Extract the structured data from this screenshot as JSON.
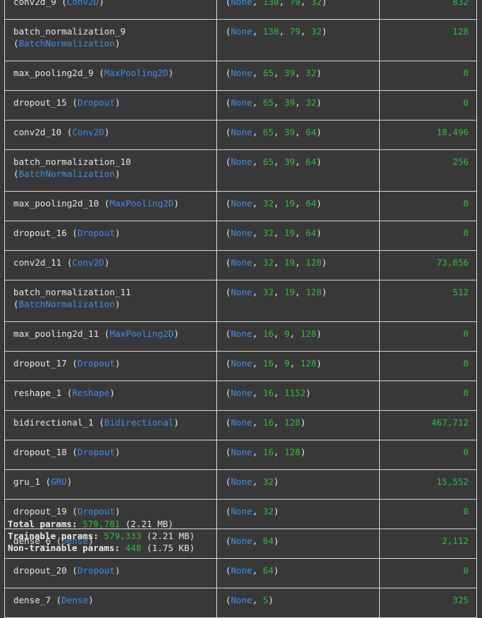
{
  "layers": [
    {
      "name": "conv2d_9",
      "type": "Conv2D",
      "shape": [
        "130",
        "79",
        "32"
      ],
      "params": "832",
      "wrap": false
    },
    {
      "name": "batch_normalization_9",
      "type": "BatchNormalization",
      "shape": [
        "130",
        "79",
        "32"
      ],
      "params": "128",
      "wrap": true
    },
    {
      "name": "max_pooling2d_9",
      "type": "MaxPooling2D",
      "shape": [
        "65",
        "39",
        "32"
      ],
      "params": "0",
      "wrap": false
    },
    {
      "name": "dropout_15",
      "type": "Dropout",
      "shape": [
        "65",
        "39",
        "32"
      ],
      "params": "0",
      "wrap": false
    },
    {
      "name": "conv2d_10",
      "type": "Conv2D",
      "shape": [
        "65",
        "39",
        "64"
      ],
      "params": "18,496",
      "wrap": false
    },
    {
      "name": "batch_normalization_10",
      "type": "BatchNormalization",
      "shape": [
        "65",
        "39",
        "64"
      ],
      "params": "256",
      "wrap": true
    },
    {
      "name": "max_pooling2d_10",
      "type": "MaxPooling2D",
      "shape": [
        "32",
        "19",
        "64"
      ],
      "params": "0",
      "wrap": false
    },
    {
      "name": "dropout_16",
      "type": "Dropout",
      "shape": [
        "32",
        "19",
        "64"
      ],
      "params": "0",
      "wrap": false
    },
    {
      "name": "conv2d_11",
      "type": "Conv2D",
      "shape": [
        "32",
        "19",
        "128"
      ],
      "params": "73,856",
      "wrap": false
    },
    {
      "name": "batch_normalization_11",
      "type": "BatchNormalization",
      "shape": [
        "32",
        "19",
        "128"
      ],
      "params": "512",
      "wrap": true
    },
    {
      "name": "max_pooling2d_11",
      "type": "MaxPooling2D",
      "shape": [
        "16",
        "9",
        "128"
      ],
      "params": "0",
      "wrap": false
    },
    {
      "name": "dropout_17",
      "type": "Dropout",
      "shape": [
        "16",
        "9",
        "128"
      ],
      "params": "0",
      "wrap": false
    },
    {
      "name": "reshape_1",
      "type": "Reshape",
      "shape": [
        "16",
        "1152"
      ],
      "params": "0",
      "wrap": false
    },
    {
      "name": "bidirectional_1",
      "type": "Bidirectional",
      "shape": [
        "16",
        "128"
      ],
      "params": "467,712",
      "wrap": false
    },
    {
      "name": "dropout_18",
      "type": "Dropout",
      "shape": [
        "16",
        "128"
      ],
      "params": "0",
      "wrap": false
    },
    {
      "name": "gru_1",
      "type": "GRU",
      "shape": [
        "32"
      ],
      "params": "15,552",
      "wrap": false
    },
    {
      "name": "dropout_19",
      "type": "Dropout",
      "shape": [
        "32"
      ],
      "params": "0",
      "wrap": false
    },
    {
      "name": "dense_6",
      "type": "Dense",
      "shape": [
        "64"
      ],
      "params": "2,112",
      "wrap": false
    },
    {
      "name": "dropout_20",
      "type": "Dropout",
      "shape": [
        "64"
      ],
      "params": "0",
      "wrap": false
    },
    {
      "name": "dense_7",
      "type": "Dense",
      "shape": [
        "5"
      ],
      "params": "325",
      "wrap": false
    }
  ],
  "shape_none": "None",
  "totals": {
    "total_label": "Total params:",
    "total_value": "579,781",
    "total_size": "(2.21 MB)",
    "trainable_label": "Trainable params:",
    "trainable_value": "579,333",
    "trainable_size": "(2.21 MB)",
    "nontrainable_label": "Non-trainable params:",
    "nontrainable_value": "448",
    "nontrainable_size": "(1.75 KB)"
  },
  "colors": {
    "background": "#383838",
    "text": "#e6e6e6",
    "type_blue": "#3b8eea",
    "number_green": "#2ebc3a",
    "border": "#d8d8d8"
  }
}
